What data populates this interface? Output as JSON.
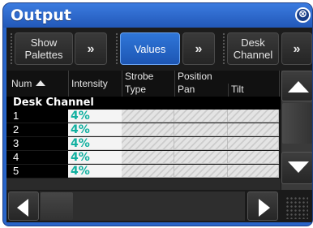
{
  "window": {
    "title": "Output",
    "close_glyph": "⊗",
    "accent": "#2864c8"
  },
  "toolbar": {
    "show_palettes": "Show\nPalettes",
    "more_1": "»",
    "values": "Values",
    "more_2": "»",
    "desk_channel": "Desk\nChannel",
    "more_3": "»"
  },
  "columns": {
    "num": "Num",
    "intensity": "Intensity",
    "strobe_top": "Strobe",
    "strobe_bottom": "Type",
    "position_top": "Position",
    "pan": "Pan",
    "tilt": "Tilt"
  },
  "group": {
    "label": "Desk Channel"
  },
  "rows": [
    {
      "num": "1",
      "intensity": "4%"
    },
    {
      "num": "2",
      "intensity": "4%"
    },
    {
      "num": "3",
      "intensity": "4%"
    },
    {
      "num": "4",
      "intensity": "4%"
    },
    {
      "num": "5",
      "intensity": "4%"
    }
  ],
  "colors": {
    "intensity_text": "#10b0a0",
    "active_button": "#1d56b4"
  },
  "icons": {
    "sort": "sort-ascending-icon",
    "scroll_up": "arrow-up-icon",
    "scroll_down": "arrow-down-icon",
    "scroll_left": "arrow-left-icon",
    "scroll_right": "arrow-right-icon",
    "resize": "resize-grip-icon"
  }
}
